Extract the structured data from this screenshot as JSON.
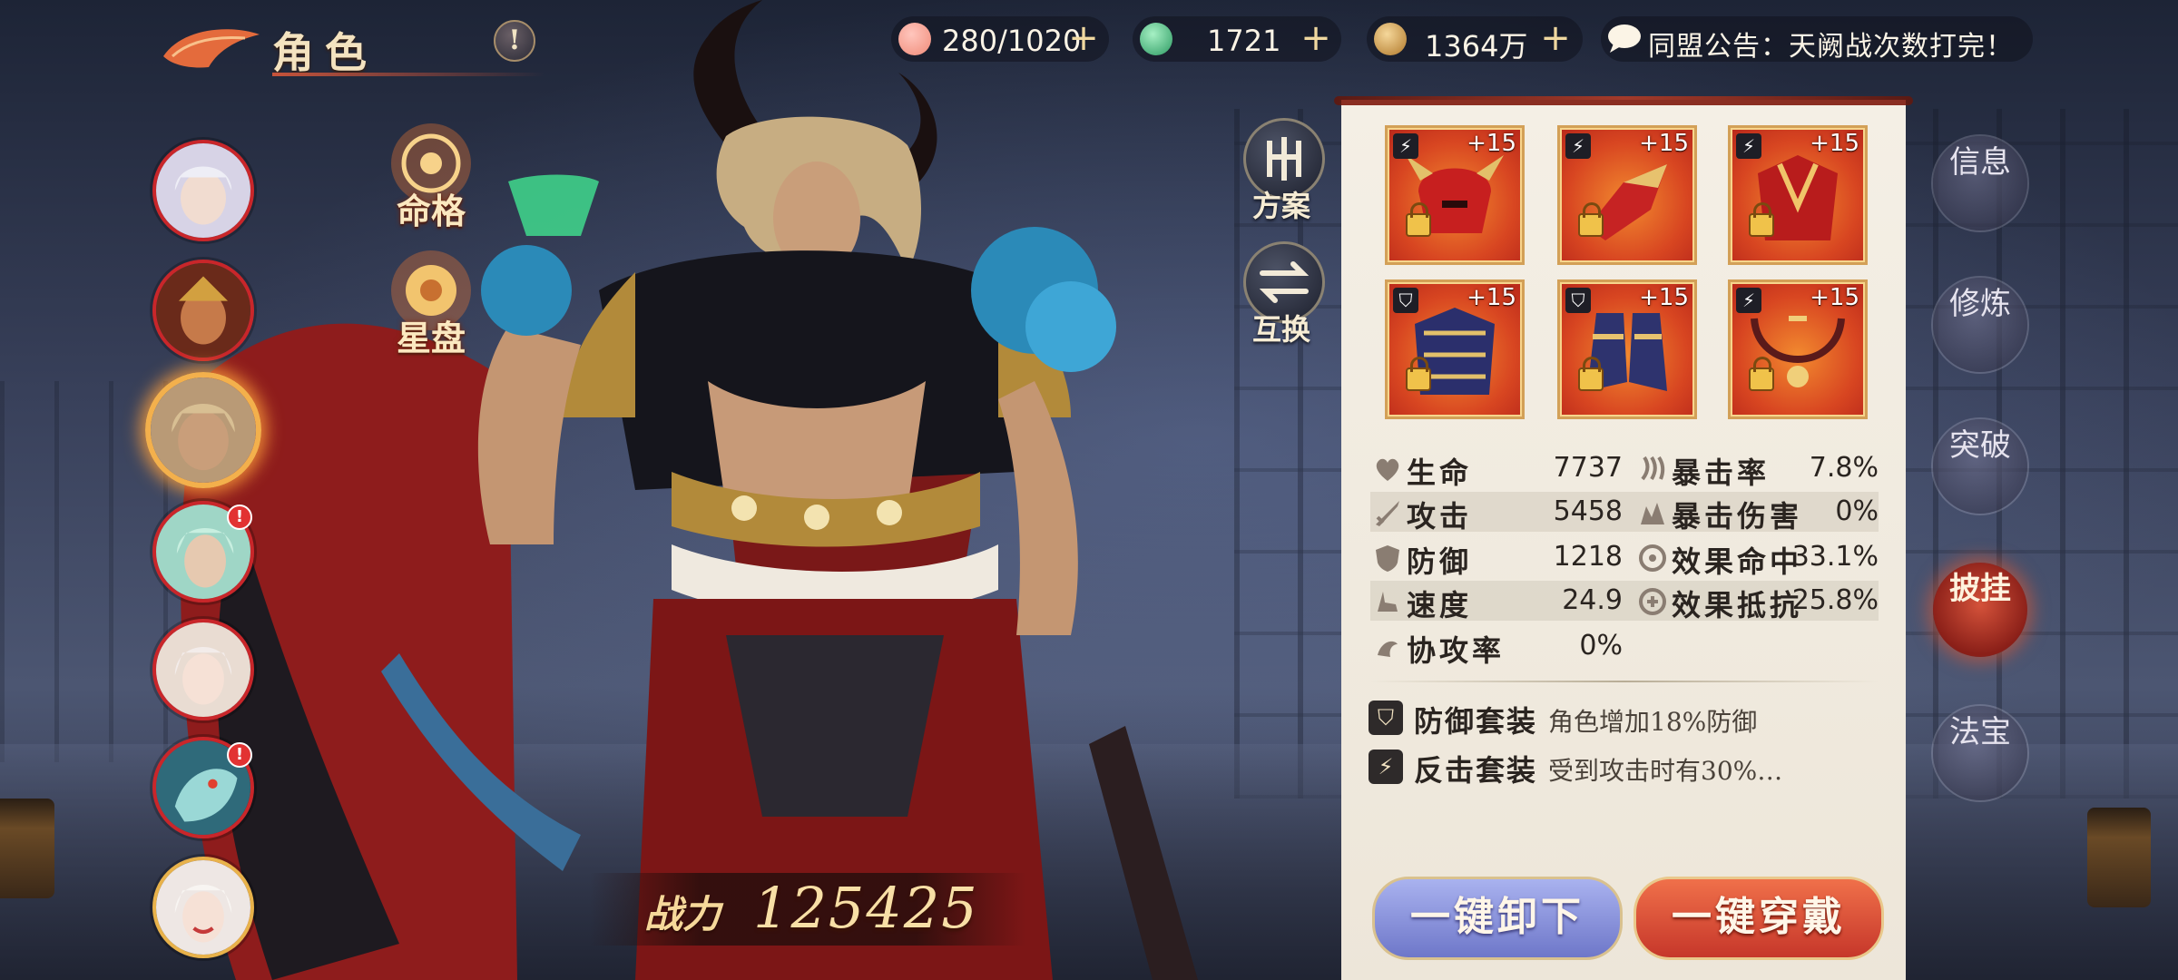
{
  "header": {
    "title": "角色",
    "notice_symbol": "!"
  },
  "resources": [
    {
      "name": "peach",
      "value": "280/1020",
      "plus": "+",
      "color": "#f59a8c"
    },
    {
      "name": "jade",
      "value": "1721",
      "plus": "+",
      "color": "#4fc08a"
    },
    {
      "name": "coin",
      "value": "1364万",
      "plus": "+",
      "color": "#d9a24a"
    }
  ],
  "announcement": {
    "text": "同盟公告：天阙战次数打完！"
  },
  "left_buttons": {
    "minge": "命格",
    "xingpan": "星盘"
  },
  "plan_buttons": {
    "plan": "方案",
    "swap": "互换"
  },
  "power": {
    "label": "战力",
    "value": "125425"
  },
  "equipment": [
    {
      "level": "+15",
      "set": "counter",
      "slot": "helmet",
      "locked": true
    },
    {
      "level": "+15",
      "set": "counter",
      "slot": "gauntlet",
      "locked": true
    },
    {
      "level": "+15",
      "set": "counter",
      "slot": "armor",
      "locked": true
    },
    {
      "level": "+15",
      "set": "defense",
      "slot": "chest",
      "locked": true
    },
    {
      "level": "+15",
      "set": "defense",
      "slot": "boots",
      "locked": true
    },
    {
      "level": "+15",
      "set": "counter",
      "slot": "necklace",
      "locked": true
    }
  ],
  "stats": [
    {
      "name": "生命",
      "value": "7737",
      "icon": "heart-icon"
    },
    {
      "name": "暴击率",
      "value": "7.8%",
      "icon": "crit-rate-icon"
    },
    {
      "name": "攻击",
      "value": "5458",
      "icon": "sword-icon"
    },
    {
      "name": "暴击伤害",
      "value": "0%",
      "icon": "crit-damage-icon"
    },
    {
      "name": "防御",
      "value": "1218",
      "icon": "shield-icon"
    },
    {
      "name": "效果命中",
      "value": "33.1%",
      "icon": "effect-hit-icon"
    },
    {
      "name": "速度",
      "value": "24.9",
      "icon": "speed-icon"
    },
    {
      "name": "效果抵抗",
      "value": "25.8%",
      "icon": "effect-resist-icon"
    },
    {
      "name": "协攻率",
      "value": "0%",
      "icon": "coop-attack-icon"
    }
  ],
  "sets": [
    {
      "name": "防御套装",
      "desc": "角色增加18%防御",
      "icon": "shield-set-icon"
    },
    {
      "name": "反击套装",
      "desc": "受到攻击时有30%…",
      "icon": "counter-set-icon"
    }
  ],
  "actions": {
    "unequip_all": "一键卸下",
    "equip_all": "一键穿戴"
  },
  "right_tabs": [
    {
      "label": "信息",
      "active": false
    },
    {
      "label": "修炼",
      "active": false
    },
    {
      "label": "突破",
      "active": false
    },
    {
      "label": "披挂",
      "active": true
    },
    {
      "label": "法宝",
      "active": false
    }
  ],
  "colors": {
    "accent_red": "#c6372a",
    "panel_bg": "#f4efe5",
    "gold": "#f3b04c"
  }
}
